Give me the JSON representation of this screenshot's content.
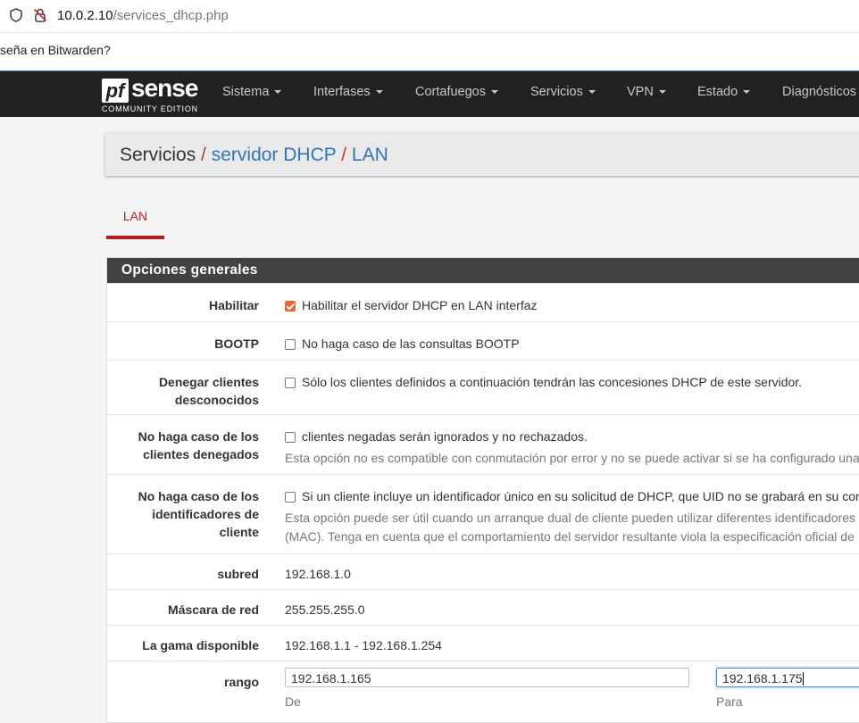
{
  "browser": {
    "url_host": "10.0.2.10",
    "url_path": "/services_dhcp.php"
  },
  "bitwarden_bar": {
    "text": "seña en Bitwarden?"
  },
  "logo": {
    "pf": "pf",
    "sense": "sense",
    "edition": "COMMUNITY EDITION"
  },
  "nav": {
    "items": [
      "Sistema",
      "Interfases",
      "Cortafuegos",
      "Servicios",
      "VPN",
      "Estado",
      "Diagnósticos"
    ]
  },
  "breadcrumb": {
    "root": "Servicios",
    "separator": "/",
    "level2": "servidor DHCP",
    "level3": "LAN"
  },
  "tabs": [
    {
      "label": "LAN",
      "active": true
    }
  ],
  "panel": {
    "title": "Opciones generales",
    "rows": {
      "habilitar": {
        "label": "Habilitar",
        "checked": true,
        "text": "Habilitar el servidor DHCP en LAN interfaz"
      },
      "bootp": {
        "label": "BOOTP",
        "checked": false,
        "text": "No haga caso de las consultas BOOTP"
      },
      "denegar": {
        "label": "Denegar clientes desconocidos",
        "checked": false,
        "text": "Sólo los clientes definidos a continuación tendrán las concesiones DHCP de este servidor."
      },
      "denegados": {
        "label": "No haga caso de los clientes denegados",
        "checked": false,
        "text": "clientes negadas serán ignorados y no rechazados.",
        "hint": "Esta opción no es compatible con conmutación por error y no se puede activar si se ha configurado una"
      },
      "identificadores": {
        "label": "No haga caso de los identificadores de cliente",
        "checked": false,
        "text": "Si un cliente incluye un identificador único en su solicitud de DHCP, que UID no se grabará en su contr",
        "hint1": "Esta opción puede ser útil cuando un arranque dual de cliente pueden utilizar diferentes identificadores d",
        "hint2": "(MAC). Tenga en cuenta que el comportamiento del servidor resultante viola la especificación oficial de"
      },
      "subred": {
        "label": "subred",
        "value": "192.168.1.0"
      },
      "mascara": {
        "label": "Máscara de red",
        "value": "255.255.255.0"
      },
      "gama": {
        "label": "La gama disponible",
        "value": "192.168.1.1 - 192.168.1.254"
      },
      "rango": {
        "label": "rango",
        "from_value": "192.168.1.165",
        "to_value": "192.168.1.175",
        "from_label": "De",
        "to_label": "Para"
      }
    }
  },
  "colors": {
    "navbar": "#212121",
    "accent_red": "#b71c1c",
    "link_blue": "#3275b5",
    "checkbox_orange": "#e8662b"
  }
}
